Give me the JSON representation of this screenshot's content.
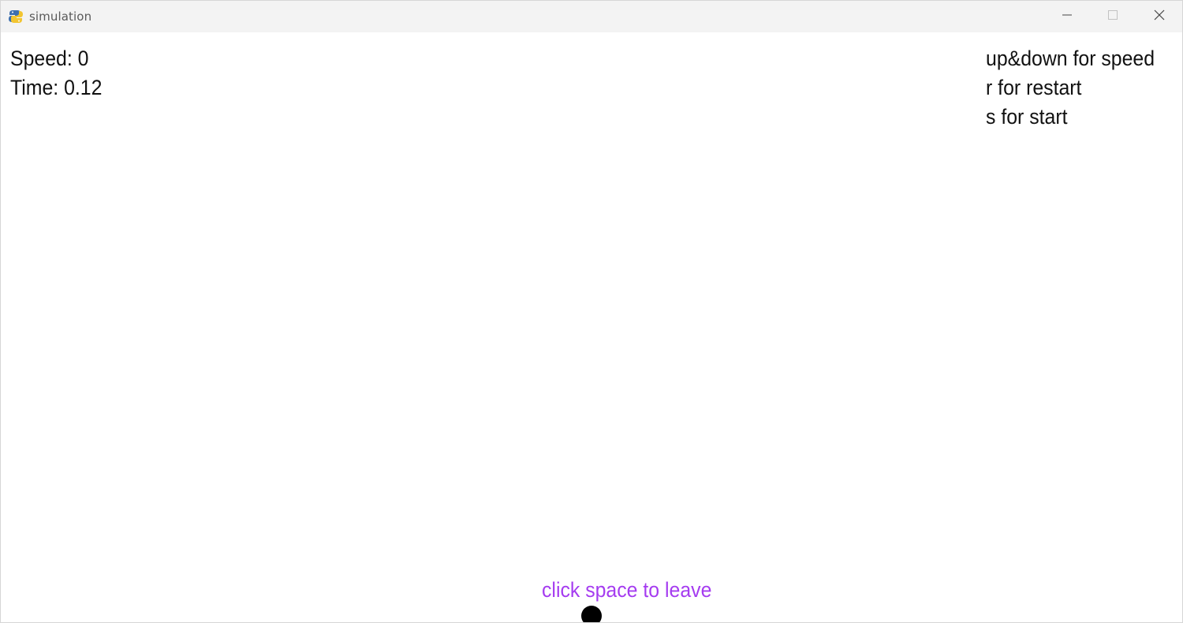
{
  "window": {
    "title": "simulation",
    "icon": "pygame-snake-icon",
    "controls": [
      "minimize-icon",
      "maximize-icon",
      "close-icon"
    ]
  },
  "hud": {
    "speed": "Speed: 0",
    "time": "Time: 0.12"
  },
  "help": {
    "line1": "up&down for speed",
    "line2": "r for restart",
    "line3": "s for start"
  },
  "footer": {
    "message": "click space to leave"
  },
  "colors": {
    "background": "#ffffff",
    "titlebar": "#f3f3f3",
    "text": "#111111",
    "message": "#a53cf0",
    "ball": "#000000"
  }
}
